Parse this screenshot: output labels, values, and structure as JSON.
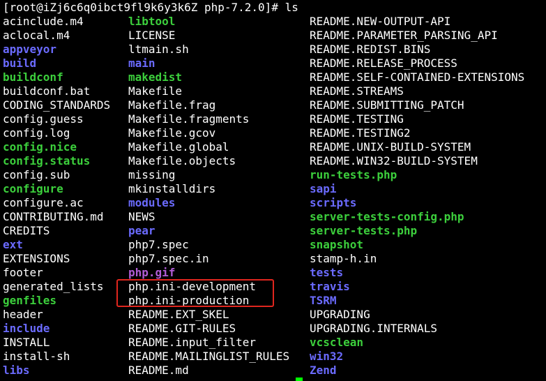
{
  "terminal": {
    "prompt": "[root@iZj6c6q0ibct9fl9k6y3k6Z php-7.2.0]# ls",
    "columns": [
      [
        {
          "name": "acinclude.m4",
          "type": "file"
        },
        {
          "name": "aclocal.m4",
          "type": "file"
        },
        {
          "name": "appveyor",
          "type": "dir"
        },
        {
          "name": "build",
          "type": "dir"
        },
        {
          "name": "buildconf",
          "type": "exec"
        },
        {
          "name": "buildconf.bat",
          "type": "file"
        },
        {
          "name": "CODING_STANDARDS",
          "type": "file"
        },
        {
          "name": "config.guess",
          "type": "file"
        },
        {
          "name": "config.log",
          "type": "file"
        },
        {
          "name": "config.nice",
          "type": "exec"
        },
        {
          "name": "config.status",
          "type": "exec"
        },
        {
          "name": "config.sub",
          "type": "file"
        },
        {
          "name": "configure",
          "type": "exec"
        },
        {
          "name": "configure.ac",
          "type": "file"
        },
        {
          "name": "CONTRIBUTING.md",
          "type": "file"
        },
        {
          "name": "CREDITS",
          "type": "file"
        },
        {
          "name": "ext",
          "type": "dir"
        },
        {
          "name": "EXTENSIONS",
          "type": "file"
        },
        {
          "name": "footer",
          "type": "file"
        },
        {
          "name": "generated_lists",
          "type": "file"
        },
        {
          "name": "genfiles",
          "type": "exec"
        },
        {
          "name": "header",
          "type": "file"
        },
        {
          "name": "include",
          "type": "dir"
        },
        {
          "name": "INSTALL",
          "type": "file"
        },
        {
          "name": "install-sh",
          "type": "file"
        },
        {
          "name": "libs",
          "type": "dir"
        }
      ],
      [
        {
          "name": "libtool",
          "type": "exec"
        },
        {
          "name": "LICENSE",
          "type": "file"
        },
        {
          "name": "ltmain.sh",
          "type": "file"
        },
        {
          "name": "main",
          "type": "dir"
        },
        {
          "name": "makedist",
          "type": "exec"
        },
        {
          "name": "Makefile",
          "type": "file"
        },
        {
          "name": "Makefile.frag",
          "type": "file"
        },
        {
          "name": "Makefile.fragments",
          "type": "file"
        },
        {
          "name": "Makefile.gcov",
          "type": "file"
        },
        {
          "name": "Makefile.global",
          "type": "file"
        },
        {
          "name": "Makefile.objects",
          "type": "file"
        },
        {
          "name": "missing",
          "type": "file"
        },
        {
          "name": "mkinstalldirs",
          "type": "file"
        },
        {
          "name": "modules",
          "type": "dir"
        },
        {
          "name": "NEWS",
          "type": "file"
        },
        {
          "name": "pear",
          "type": "dir"
        },
        {
          "name": "php7.spec",
          "type": "file"
        },
        {
          "name": "php7.spec.in",
          "type": "file"
        },
        {
          "name": "php.gif",
          "type": "img"
        },
        {
          "name": "php.ini-development",
          "type": "file"
        },
        {
          "name": "php.ini-production",
          "type": "file"
        },
        {
          "name": "README.EXT_SKEL",
          "type": "file"
        },
        {
          "name": "README.GIT-RULES",
          "type": "file"
        },
        {
          "name": "README.input_filter",
          "type": "file"
        },
        {
          "name": "README.MAILINGLIST_RULES",
          "type": "file"
        },
        {
          "name": "README.md",
          "type": "file"
        }
      ],
      [
        {
          "name": "README.NEW-OUTPUT-API",
          "type": "file"
        },
        {
          "name": "README.PARAMETER_PARSING_API",
          "type": "file"
        },
        {
          "name": "README.REDIST.BINS",
          "type": "file"
        },
        {
          "name": "README.RELEASE_PROCESS",
          "type": "file"
        },
        {
          "name": "README.SELF-CONTAINED-EXTENSIONS",
          "type": "file"
        },
        {
          "name": "README.STREAMS",
          "type": "file"
        },
        {
          "name": "README.SUBMITTING_PATCH",
          "type": "file"
        },
        {
          "name": "README.TESTING",
          "type": "file"
        },
        {
          "name": "README.TESTING2",
          "type": "file"
        },
        {
          "name": "README.UNIX-BUILD-SYSTEM",
          "type": "file"
        },
        {
          "name": "README.WIN32-BUILD-SYSTEM",
          "type": "file"
        },
        {
          "name": "run-tests.php",
          "type": "exec"
        },
        {
          "name": "sapi",
          "type": "dir"
        },
        {
          "name": "scripts",
          "type": "dir"
        },
        {
          "name": "server-tests-config.php",
          "type": "exec"
        },
        {
          "name": "server-tests.php",
          "type": "exec"
        },
        {
          "name": "snapshot",
          "type": "exec"
        },
        {
          "name": "stamp-h.in",
          "type": "file"
        },
        {
          "name": "tests",
          "type": "dir"
        },
        {
          "name": "travis",
          "type": "dir"
        },
        {
          "name": "TSRM",
          "type": "dir"
        },
        {
          "name": "UPGRADING",
          "type": "file"
        },
        {
          "name": "UPGRADING.INTERNALS",
          "type": "file"
        },
        {
          "name": "vcsclean",
          "type": "exec"
        },
        {
          "name": "win32",
          "type": "dir"
        },
        {
          "name": "Zend",
          "type": "dir"
        }
      ]
    ],
    "colors": {
      "background": "#000000",
      "text": "#ffffff",
      "directory": "#6b6bff",
      "executable": "#3ccf3c",
      "image": "#b05cd6",
      "highlight_box": "#e0261e",
      "cursor": "#00ff00"
    }
  }
}
